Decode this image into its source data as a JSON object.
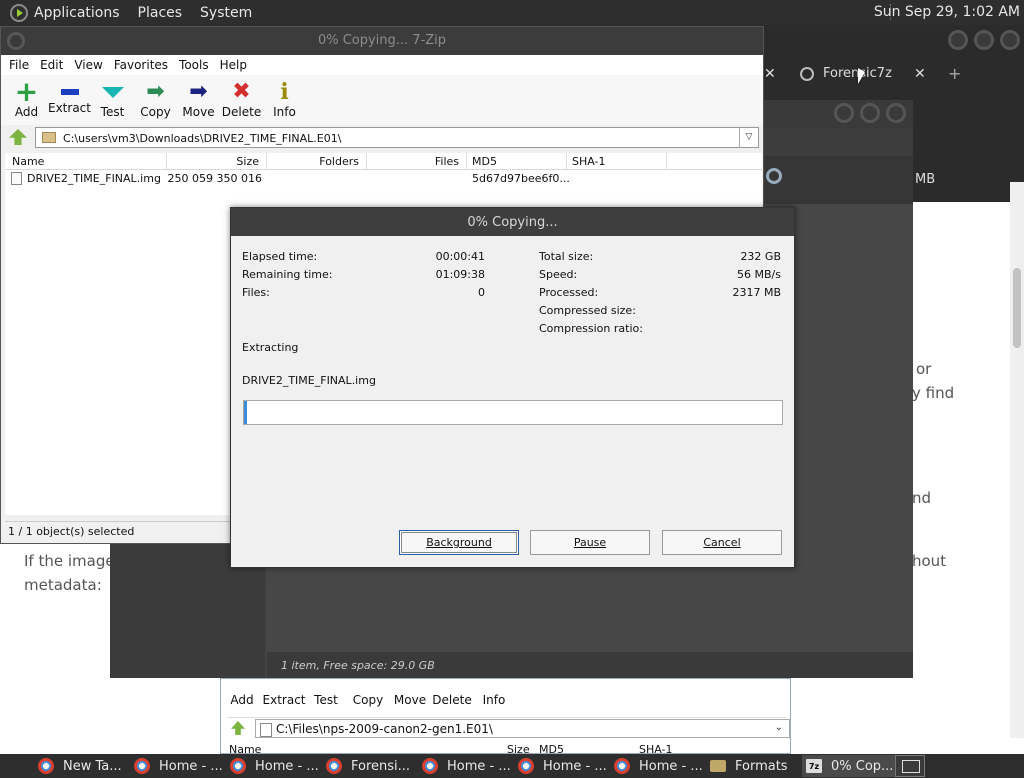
{
  "top_panel": {
    "menus": [
      "Applications",
      "Places",
      "System"
    ],
    "clock": "Sun Sep 29,  1:02 AM"
  },
  "browser": {
    "tab_label": "Forensic7z",
    "close_glyph": "✕",
    "new_tab_glyph": "+"
  },
  "webpage": {
    "frag_or": "or",
    "frag_find": "y find",
    "frag_nd": "nd",
    "frag_if_image": "If the image",
    "frag_metadata": "metadata:",
    "frag_hout": "hout"
  },
  "file_manager": {
    "size_text": "MB",
    "status": "1 item, Free space: 29.0 GB"
  },
  "zip_main": {
    "title": "0% Copying... 7-Zip",
    "menu": [
      "File",
      "Edit",
      "View",
      "Favorites",
      "Tools",
      "Help"
    ],
    "toolbar": [
      {
        "label": "Add",
        "icon": "add-icon"
      },
      {
        "label": "Extract",
        "icon": "extract-icon"
      },
      {
        "label": "Test",
        "icon": "test-icon"
      },
      {
        "label": "Copy",
        "icon": "copy-icon"
      },
      {
        "label": "Move",
        "icon": "move-icon"
      },
      {
        "label": "Delete",
        "icon": "delete-icon"
      },
      {
        "label": "Info",
        "icon": "info-icon"
      }
    ],
    "glyphs": {
      "add": "+",
      "copy": "➡",
      "move": "➡",
      "delete": "✖",
      "info": "i",
      "dropdown": "▽"
    },
    "path": "C:\\users\\vm3\\Downloads\\DRIVE2_TIME_FINAL.E01\\",
    "columns": [
      "Name",
      "Size",
      "Folders",
      "Files",
      "MD5",
      "SHA-1"
    ],
    "rows": [
      {
        "name": "DRIVE2_TIME_FINAL.img",
        "size": "250 059 350 016",
        "md5": "5d67d97bee6f0..."
      }
    ],
    "status": "1 / 1 object(s) selected"
  },
  "dialog": {
    "title": "0% Copying...",
    "elapsed_label": "Elapsed time:",
    "elapsed": "00:00:41",
    "remaining_label": "Remaining time:",
    "remaining": "01:09:38",
    "files_label": "Files:",
    "files": "0",
    "total_label": "Total size:",
    "total": "232 GB",
    "speed_label": "Speed:",
    "speed": "56 MB/s",
    "processed_label": "Processed:",
    "processed": "2317 MB",
    "compressed_label": "Compressed size:",
    "ratio_label": "Compression ratio:",
    "action": "Extracting",
    "current_file": "DRIVE2_TIME_FINAL.img",
    "progress_percent": 0.6,
    "buttons": {
      "background": "Background",
      "pause": "Pause",
      "cancel": "Cancel"
    }
  },
  "zip_second": {
    "toolbar": [
      "Add",
      "Extract",
      "Test",
      "Copy",
      "Move",
      "Delete",
      "Info"
    ],
    "path": "C:\\Files\\nps-2009-canon2-gen1.E01\\",
    "dropdown_glyph": "⌄",
    "columns": [
      "Name",
      "Size",
      "MD5",
      "SHA-1"
    ]
  },
  "taskbar": {
    "tasks": [
      {
        "label": "New Ta...",
        "type": "browser"
      },
      {
        "label": "Home - ...",
        "type": "browser"
      },
      {
        "label": "Home - ...",
        "type": "browser"
      },
      {
        "label": "Forensi...",
        "type": "browser"
      },
      {
        "label": "Home - ...",
        "type": "browser"
      },
      {
        "label": "Home - ...",
        "type": "browser"
      },
      {
        "label": "Home - ...",
        "type": "browser"
      },
      {
        "label": "Formats",
        "type": "folder"
      },
      {
        "label": "0% Cop...",
        "type": "7z"
      }
    ],
    "z7_badge": "7z"
  },
  "colors": {
    "progress_fill": "#3a8fd8",
    "panel": "#2e2e2e"
  }
}
